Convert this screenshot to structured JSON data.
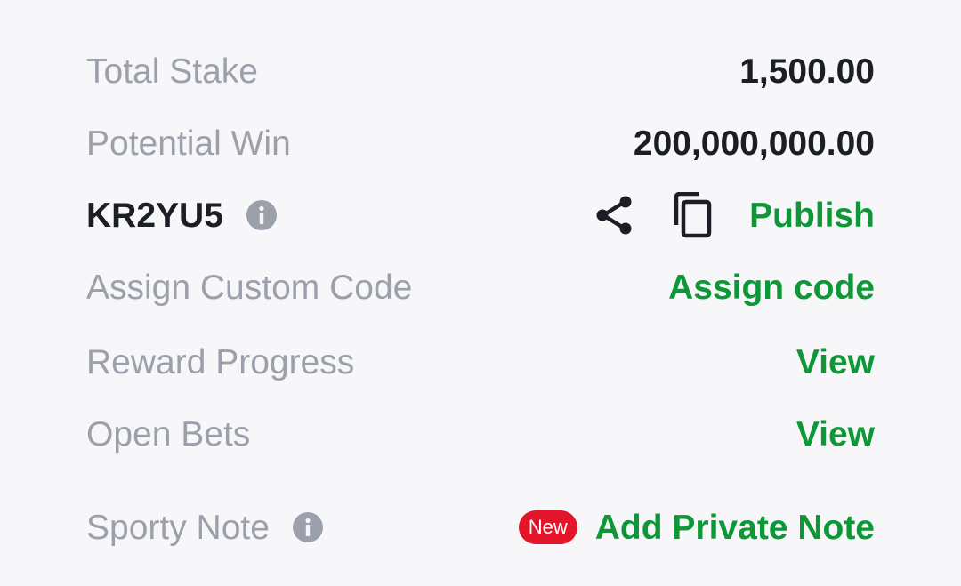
{
  "summary": {
    "total_stake_label": "Total Stake",
    "total_stake_value": "1,500.00",
    "potential_win_label": "Potential Win",
    "potential_win_value": "200,000,000.00"
  },
  "booking": {
    "code": "KR2YU5",
    "info_icon": "info-icon",
    "share_icon": "share-icon",
    "copy_icon": "copy-icon",
    "publish_label": "Publish"
  },
  "rows": {
    "assign_custom_code_label": "Assign Custom Code",
    "assign_code_action": "Assign code",
    "reward_progress_label": "Reward Progress",
    "reward_progress_action": "View",
    "open_bets_label": "Open Bets",
    "open_bets_action": "View",
    "sporty_note_label": "Sporty Note",
    "sporty_note_badge": "New",
    "sporty_note_action": "Add Private Note"
  },
  "colors": {
    "background": "#f7f7f9",
    "label_gray": "#9ca0ab",
    "value_dark": "#1b1e25",
    "action_green": "#0d9737",
    "badge_red": "#e4152a"
  }
}
